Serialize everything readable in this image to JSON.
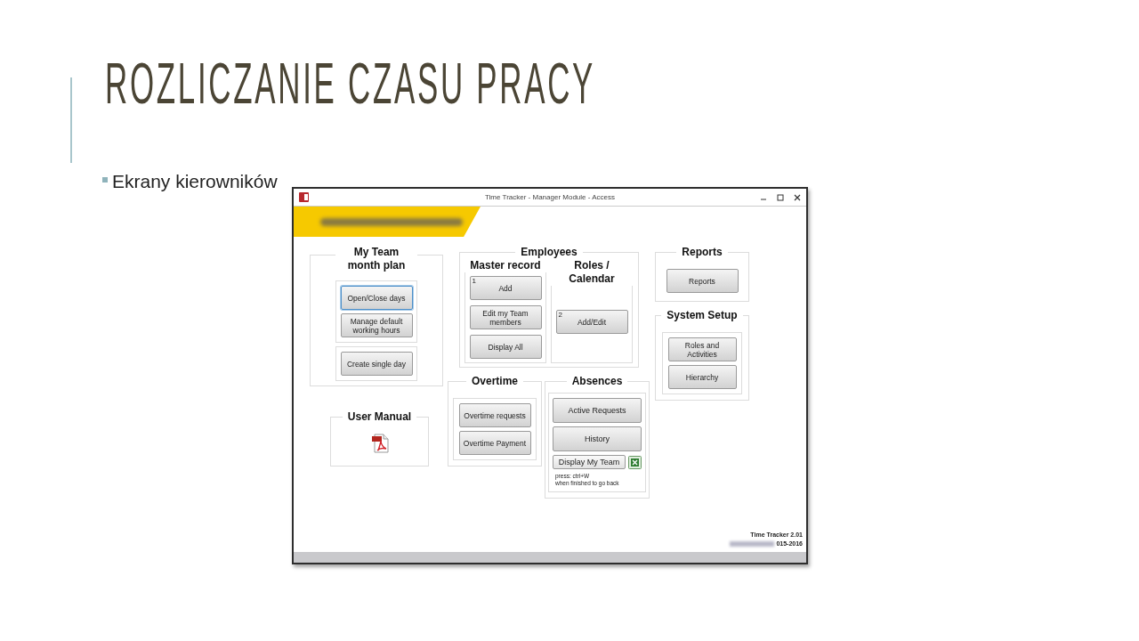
{
  "slide": {
    "title": "ROZLICZANIE CZASU PRACY",
    "bullets": [
      "Ekrany kierowników"
    ]
  },
  "window": {
    "title": "Time Tracker - Manager Module - Access",
    "columns": [
      [
        {
          "kind": "group",
          "title": "My Team month plan",
          "panels": [
            {
              "buttons": [
                {
                  "label": "Open/Close days",
                  "focused": true
                },
                {
                  "label": "Manage default working hours",
                  "focused": false
                }
              ]
            },
            {
              "buttons": [
                {
                  "label": "Create single day",
                  "focused": false
                }
              ]
            }
          ]
        },
        {
          "kind": "manual",
          "title": "User Manual"
        }
      ],
      [
        {
          "kind": "split",
          "title": "Employees",
          "subgroups": [
            {
              "title": "Master record",
              "buttons": [
                {
                  "label": "Add",
                  "tag": "1",
                  "focused": false
                },
                {
                  "label": "Edit my Team members",
                  "focused": false
                },
                {
                  "label": "Display All",
                  "focused": false
                }
              ]
            },
            {
              "title": "Roles / Calendar",
              "buttons": [
                {
                  "label": "Add/Edit",
                  "tag": "2",
                  "focused": false
                }
              ]
            }
          ]
        },
        {
          "kind": "row",
          "groups": [
            {
              "kind": "group",
              "title": "Overtime",
              "panels": [
                {
                  "buttons": [
                    {
                      "label": "Overtime requests",
                      "focused": false
                    },
                    {
                      "label": "Overtime Payment",
                      "focused": false
                    }
                  ]
                }
              ]
            },
            {
              "kind": "group",
              "title": "Absences",
              "panels": [
                {
                  "buttons": [
                    {
                      "label": "Active Requests",
                      "focused": false
                    },
                    {
                      "label": "History",
                      "focused": false
                    }
                  ],
                  "export": {
                    "label": "Display My Team",
                    "notes": [
                      "press: ctrl+W",
                      "when finished to go back"
                    ]
                  }
                }
              ]
            }
          ]
        }
      ],
      [
        {
          "kind": "group",
          "title": "Reports",
          "panels": [
            {
              "bare": true,
              "buttons": [
                {
                  "label": "Reports",
                  "focused": false
                }
              ]
            }
          ]
        },
        {
          "kind": "group",
          "title": "System Setup",
          "panels": [
            {
              "buttons": [
                {
                  "label": "Roles and Activities",
                  "focused": false
                },
                {
                  "label": "Hierarchy",
                  "focused": false
                }
              ]
            }
          ]
        }
      ]
    ],
    "footer": {
      "version": "Time Tracker 2.01",
      "copyright": "015-2016"
    }
  }
}
